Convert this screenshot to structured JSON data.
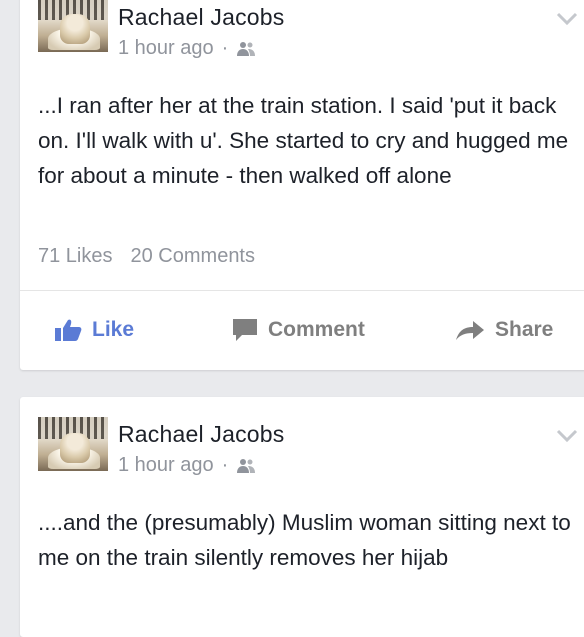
{
  "posts": [
    {
      "author": "Rachael Jacobs",
      "timestamp": "1 hour ago",
      "separator": "·",
      "audience_icon": "friends-icon",
      "text": "...I ran after her at the train station. I said 'put it back on. I'll walk with u'. She started to cry and hugged me for about a minute - then walked off alone",
      "likes": "71 Likes",
      "comments": "20 Comments",
      "actions": {
        "like": "Like",
        "comment": "Comment",
        "share": "Share"
      }
    },
    {
      "author": "Rachael Jacobs",
      "timestamp": "1 hour ago",
      "separator": "·",
      "audience_icon": "friends-icon",
      "text": "....and the (presumably) Muslim woman sitting next to me on the train silently removes her hijab"
    }
  ],
  "colors": {
    "background": "#e9eaed",
    "card": "#ffffff",
    "link_blue": "#5b7bd5",
    "meta_gray": "#90949c",
    "text": "#1d2129"
  }
}
